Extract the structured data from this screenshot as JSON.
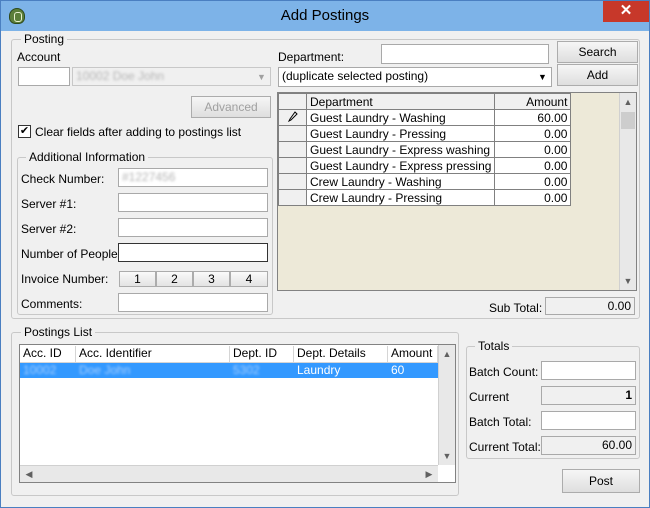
{
  "window": {
    "title": "Add Postings",
    "close_label": "✕"
  },
  "posting": {
    "legend": "Posting",
    "account_label": "Account",
    "account_code": "",
    "account_name": "10002  Doe John",
    "department_label": "Department:",
    "department_search_value": "",
    "department_select_value": "(duplicate selected posting)",
    "search_label": "Search",
    "add_label": "Add",
    "advanced_label": "Advanced",
    "clear_fields_label": "Clear fields after adding to postings list",
    "clear_fields_checked": true
  },
  "additional": {
    "legend": "Additional Information",
    "check_number_label": "Check Number:",
    "check_number_value": "#1227456",
    "server1_label": "Server #1:",
    "server2_label": "Server #2:",
    "people_label": "Number of People:",
    "invoice_label": "Invoice Number:",
    "invoice_segments": [
      "1",
      "2",
      "3",
      "4"
    ],
    "comments_label": "Comments:"
  },
  "dept_grid": {
    "columns": [
      "Department",
      "Amount"
    ],
    "rows": [
      {
        "department": "Guest Laundry - Washing",
        "amount": "60.00",
        "editing": true
      },
      {
        "department": "Guest Laundry - Pressing",
        "amount": "0.00",
        "editing": false
      },
      {
        "department": "Guest Laundry - Express washing",
        "amount": "0.00",
        "editing": false
      },
      {
        "department": "Guest Laundry - Express pressing",
        "amount": "0.00",
        "editing": false
      },
      {
        "department": "Crew Laundry - Washing",
        "amount": "0.00",
        "editing": false
      },
      {
        "department": "Crew Laundry - Pressing",
        "amount": "0.00",
        "editing": false
      }
    ],
    "edit_icon": "pencil-icon",
    "subtotal_label": "Sub Total:",
    "subtotal_value": "0.00"
  },
  "postings_list": {
    "legend": "Postings List",
    "columns": [
      "Acc. ID",
      "Acc. Identifier",
      "Dept. ID",
      "Dept. Details",
      "Amount"
    ],
    "rows": [
      {
        "acc_id": "10002",
        "acc_identifier": "Doe John",
        "dept_id": "5302",
        "dept_details": "Laundry",
        "amount": "60"
      }
    ]
  },
  "totals": {
    "legend": "Totals",
    "batch_count_label": "Batch Count:",
    "current_label": "Current",
    "current_value": "1",
    "batch_total_label": "Batch Total:",
    "current_total_label": "Current Total:",
    "current_total_value": "60.00"
  },
  "post_label": "Post",
  "colors": {
    "selection": "#3399ff",
    "titlebar": "#7db3e8",
    "close": "#c7382a"
  }
}
